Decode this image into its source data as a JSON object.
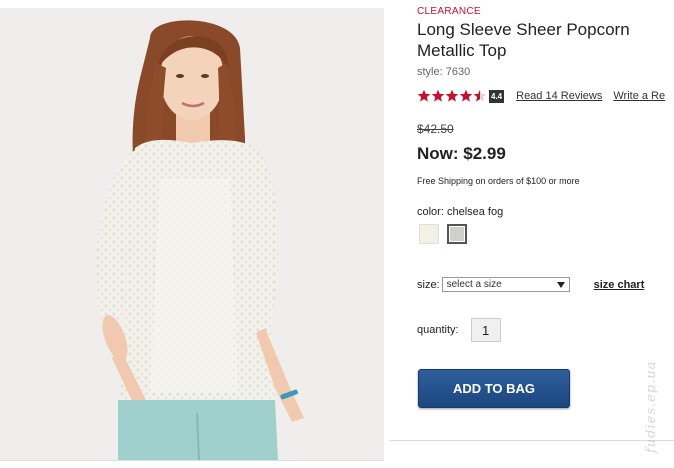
{
  "product": {
    "badge": "CLEARANCE",
    "title": "Long Sleeve Sheer Popcorn Metallic Top",
    "style_line": "style: 7630",
    "rating": {
      "stars": 4.4,
      "badge": "4.4",
      "reviews_link": "Read 14 Reviews",
      "write_link": "Write a Re"
    },
    "price": {
      "original": "$42.50",
      "now": "Now: $2.99"
    },
    "shipping": "Free Shipping on orders of $100 or more",
    "color_line": "color: chelsea fog",
    "size": {
      "label": "size:",
      "select_value": "select a size",
      "chart_link": "size chart"
    },
    "quantity": {
      "label": "quantity:",
      "value": "1"
    },
    "add_to_bag": "ADD TO BAG"
  },
  "colors": {
    "clearance": "#c8102e",
    "star": "#c8102e",
    "button": "#1c467f",
    "swatch_cream": "#f3f1e4",
    "swatch_gray": "#cfcfcc"
  },
  "watermark": "fudies.ep.ua",
  "icons": [
    "star-icon",
    "select-arrow-icon"
  ]
}
